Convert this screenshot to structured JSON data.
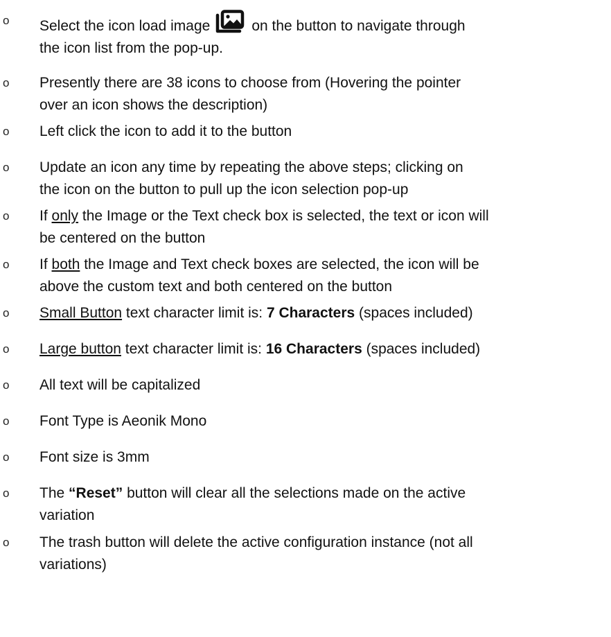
{
  "bullet_glyph": "o",
  "items": [
    {
      "p1": "Select the icon load image",
      "icon": "image-gallery-icon",
      "p2": "on the button to navigate through",
      "p3": "the icon list from the pop-up."
    },
    {
      "p1": "Presently there are 38 icons to choose from (Hovering the pointer",
      "p2": "over an icon shows the description)"
    },
    {
      "p1": "Left click the icon to add it to the button"
    },
    {
      "p1": "Update an icon any time by repeating the above steps; clicking on",
      "p2": "the icon on the button to pull up the icon selection pop-up"
    },
    {
      "pre": "If ",
      "u": "only",
      "p1": " the Image or the Text check box is selected, the text or icon will",
      "p2": "be centered on the button"
    },
    {
      "pre": "If ",
      "u": "both",
      "p1": " the Image and Text check boxes are selected, the icon will be",
      "p2": "above the custom text and both centered on the button"
    },
    {
      "u": "Small Button",
      "p1": " text character limit is: ",
      "b": "7 Characters",
      "p2": " (spaces included)"
    },
    {
      "u": "Large button",
      "p1": " text character limit is: ",
      "b": "16 Characters",
      "p2": " (spaces included)"
    },
    {
      "p1": "All text will be capitalized"
    },
    {
      "p1": "Font Type is Aeonik Mono"
    },
    {
      "p1": "Font size is 3mm"
    },
    {
      "pre": "The ",
      "q1": "“",
      "b": "Reset",
      "q2": "”",
      "p1": " button will clear all the selections made on the active",
      "p2": "variation"
    },
    {
      "p1": "The trash button will delete the active configuration instance (not all",
      "p2": "variations)"
    }
  ]
}
